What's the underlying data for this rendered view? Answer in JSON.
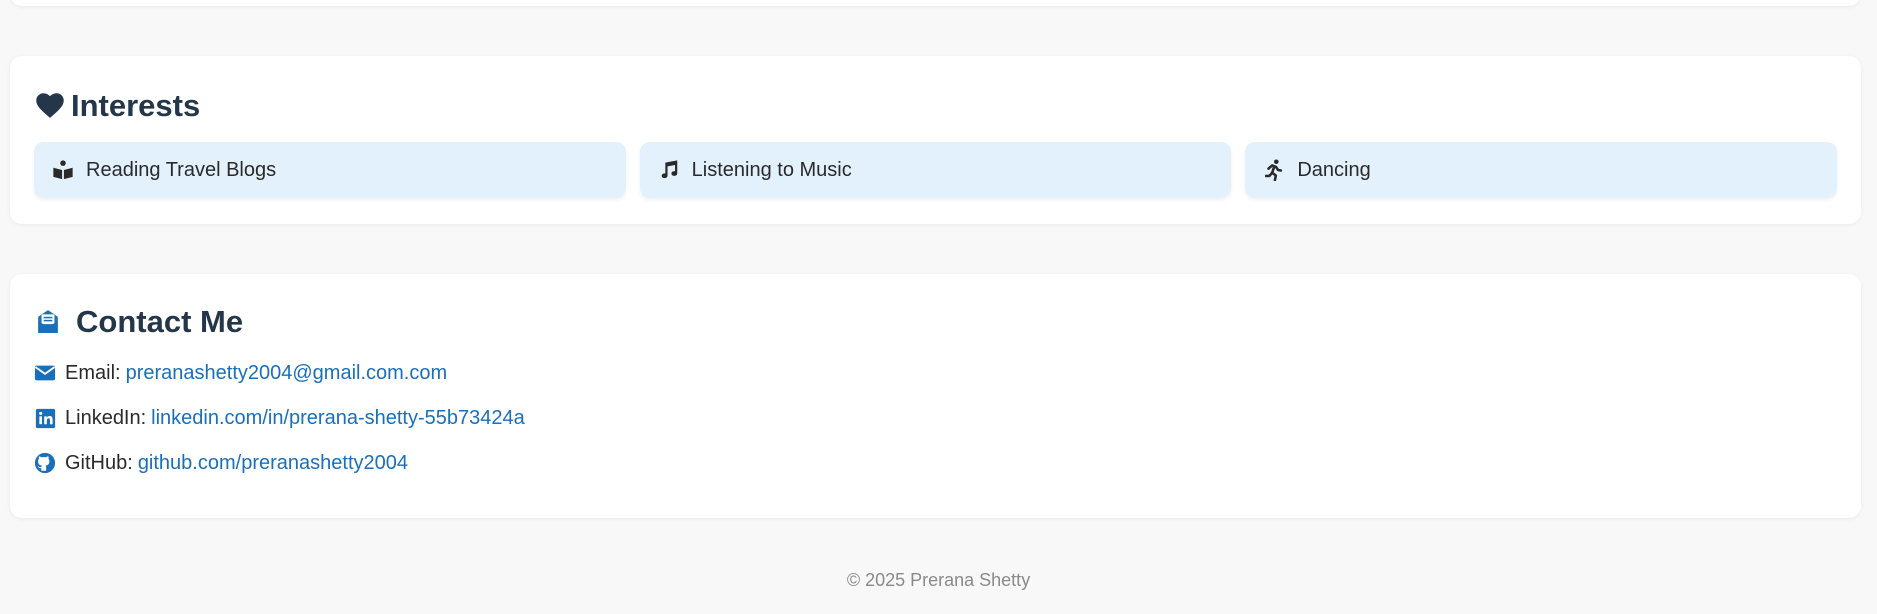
{
  "colors": {
    "page_bg": "#f8f8f8",
    "card_bg": "#ffffff",
    "heading": "#24364a",
    "accent_blue": "#1a6fba",
    "interest_bg": "#e3f1fc"
  },
  "interests": {
    "title": "Interests",
    "title_icon": "heart-icon",
    "items": [
      {
        "label": "Reading Travel Blogs",
        "icon": "book-reader-icon"
      },
      {
        "label": "Listening to Music",
        "icon": "music-note-icon"
      },
      {
        "label": "Dancing",
        "icon": "running-person-icon"
      }
    ]
  },
  "contact": {
    "title": "Contact Me",
    "title_icon": "envelope-open-text-icon",
    "items": [
      {
        "label": "Email:",
        "value": "preranashetty2004@gmail.com.com",
        "icon": "envelope-icon"
      },
      {
        "label": "LinkedIn:",
        "value": "linkedin.com/in/prerana-shetty-55b73424a",
        "icon": "linkedin-icon"
      },
      {
        "label": "GitHub:",
        "value": "github.com/preranashetty2004",
        "icon": "github-icon"
      }
    ]
  },
  "footer": {
    "text": "© 2025 Prerana Shetty"
  }
}
